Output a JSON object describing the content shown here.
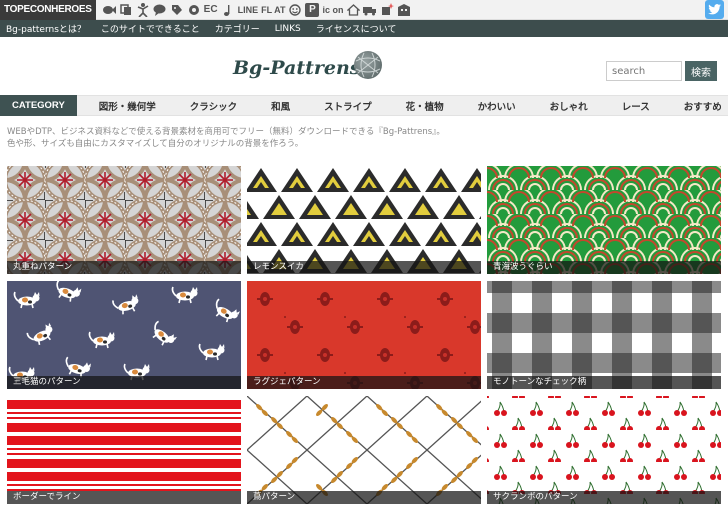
{
  "topbar": {
    "brand": "TOPECONHEROES",
    "icons": [
      "fish-icon",
      "copy-icon",
      "dancer-icon",
      "speech-bubble-icon",
      "price-tag-icon",
      "flower-icon",
      "ec-icon",
      "music-note-icon",
      "line-icon",
      "flat-icon",
      "smiley-icon",
      "p-icon",
      "icon-text-icon",
      "house-icon",
      "truck-icon",
      "sparkle-icon",
      "building-icon"
    ],
    "icon_labels": {
      "ec": "EC",
      "line": "LINE",
      "flat": "FL AT",
      "p": "P",
      "icon": "ic on"
    }
  },
  "subnav": {
    "items": [
      "Bg-patternsとは？",
      "このサイトでできること",
      "カテゴリー",
      "LINKS",
      "ライセンスについて"
    ]
  },
  "header": {
    "logo": "Bg-Pattrens",
    "search_placeholder": "search",
    "search_button": "検索"
  },
  "categories": {
    "head": "CATEGORY",
    "items": [
      "図形・幾何学",
      "クラシック",
      "和風",
      "ストライプ",
      "花・植物",
      "かわいい",
      "おしゃれ",
      "レース",
      "おすすめ"
    ]
  },
  "description": {
    "line1": "WEBやDTP、ビジネス資料などで使える背景素材を商用可でフリー（無料）ダウンロードできる『Bg-Pattrens』。",
    "line2": "色や形、サイズも自由にカスタマイズして自分のオリジナルの背景を作ろう。"
  },
  "tiles": [
    {
      "label": "丸重ねパターン",
      "colors": [
        "#a88f78",
        "#d5d5d5",
        "#b01c2b"
      ]
    },
    {
      "label": "レモンスイカ",
      "colors": [
        "#ffffff",
        "#2b2b2b",
        "#e2cd3d"
      ]
    },
    {
      "label": "青海波うぐらい",
      "colors": [
        "#239b3c",
        "#f4e8c6",
        "#c4472d"
      ]
    },
    {
      "label": "三毛猫のパターン",
      "colors": [
        "#4f5473",
        "#ffffff",
        "#d98a3d"
      ]
    },
    {
      "label": "ラグジェパターン",
      "colors": [
        "#d9382b",
        "#8c1c1a"
      ]
    },
    {
      "label": "モノトーンなチェック柄",
      "colors": [
        "#2a2a2a",
        "#ffffff",
        "#8a8a8a"
      ]
    },
    {
      "label": "ボーダーでライン",
      "colors": [
        "#e3141c",
        "#ffffff"
      ]
    },
    {
      "label": "蔦パターン",
      "colors": [
        "#ffffff",
        "#c7892d",
        "#555555"
      ]
    },
    {
      "label": "サクランボのパターン",
      "colors": [
        "#ffffff",
        "#d9141e",
        "#2d6d2d"
      ]
    }
  ]
}
